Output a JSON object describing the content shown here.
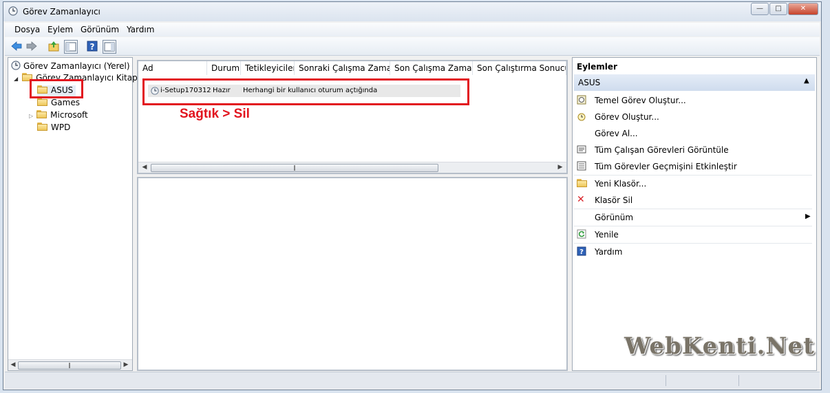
{
  "window": {
    "title": "Görev Zamanlayıcı"
  },
  "menu": [
    "Dosya",
    "Eylem",
    "Görünüm",
    "Yardım"
  ],
  "tree": {
    "root": "Görev Zamanlayıcı (Yerel)",
    "library": "Görev Zamanlayıcı Kitaplı",
    "folders": [
      "ASUS",
      "Games",
      "Microsoft",
      "WPD"
    ]
  },
  "tasks": {
    "columns": [
      "Ad",
      "Durum",
      "Tetikleyiciler",
      "Sonraki Çalışma Zamanı",
      "Son Çalışma Zamanı",
      "Son Çalıştırma Sonucu"
    ],
    "rows": [
      {
        "name": "i-Setup170312",
        "status": "Hazır",
        "trigger": "Herhangi bir kullanıcı oturum açtığında"
      }
    ]
  },
  "annotation": "Sağtık > Sil",
  "actions": {
    "header": "Eylemler",
    "section": "ASUS",
    "items": [
      {
        "label": "Temel Görev Oluştur...",
        "icon": "basic-task-icon"
      },
      {
        "label": "Görev Oluştur...",
        "icon": "create-task-icon"
      },
      {
        "label": "Görev Al...",
        "icon": ""
      },
      {
        "label": "Tüm Çalışan Görevleri Görüntüle",
        "icon": "running-tasks-icon"
      },
      {
        "label": "Tüm Görevler Geçmişini Etkinleştir",
        "icon": "history-icon"
      },
      {
        "label": "Yeni Klasör...",
        "icon": "new-folder-icon"
      },
      {
        "label": "Klasör Sil",
        "icon": "delete-icon"
      },
      {
        "label": "Görünüm",
        "icon": ""
      },
      {
        "label": "Yenile",
        "icon": "refresh-icon"
      },
      {
        "label": "Yardım",
        "icon": "help-icon"
      }
    ]
  },
  "watermark": "WebKenti.Net",
  "colors": {
    "highlight": "#e2141e",
    "section_header": "#dce7f5",
    "delete": "#d9262c"
  }
}
